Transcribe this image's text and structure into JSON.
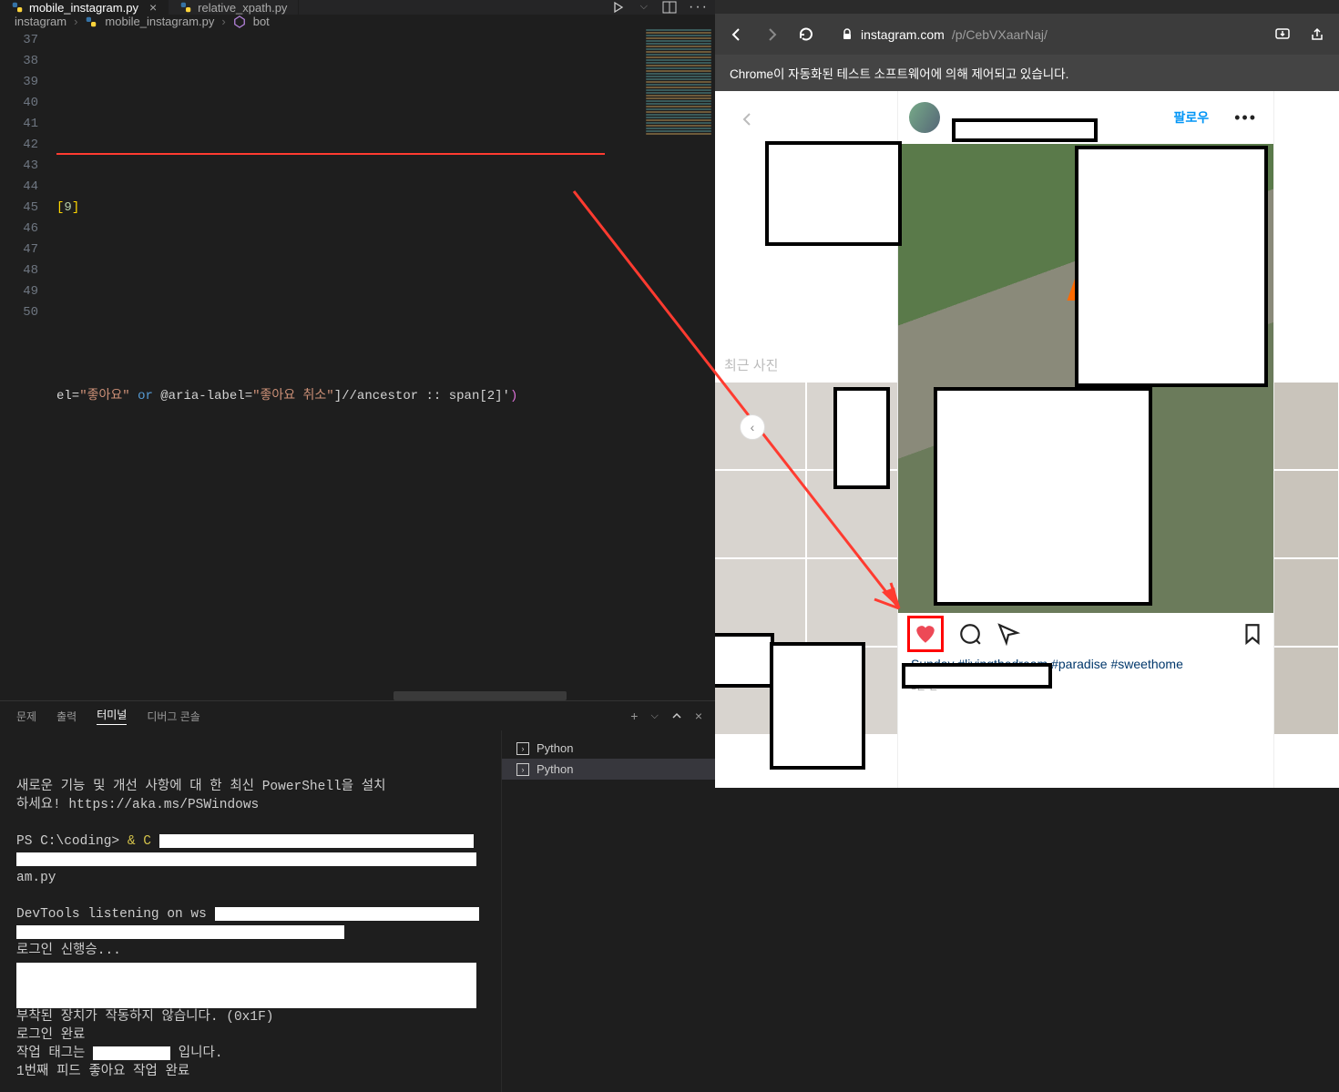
{
  "vscode": {
    "tabs": [
      {
        "name": "mobile_instagram.py",
        "active": true
      },
      {
        "name": "relative_xpath.py",
        "active": false
      }
    ],
    "breadcrumb": {
      "folder": "instagram",
      "file": "mobile_instagram.py",
      "symbol": "bot"
    },
    "gutter_lines": [
      "37",
      "38",
      "39",
      "40",
      "41",
      "42",
      "43",
      "44",
      "45",
      "46",
      "47",
      "48",
      "49",
      "50"
    ],
    "code_line_39": "[9]",
    "code_line_42_prefix": "el=",
    "code_line_42_str1": "\"좋아요\"",
    "code_line_42_or": " or ",
    "code_line_42_at": "@aria-label=",
    "code_line_42_str2": "\"좋아요 취소\"",
    "code_line_42_x": "]//ancestor :: span[2]'",
    "panel_tabs": {
      "problems": "문제",
      "output": "출력",
      "terminal": "터미널",
      "debug": "디버그 콘솔"
    },
    "terminal_list": [
      "Python",
      "Python"
    ],
    "terminal_text": {
      "l1": "새로운 기능 및 개선 사항에 대 한 최신 PowerShell을 설치",
      "l2": "하세요! https://aka.ms/PSWindows",
      "l3a": "PS C:\\coding> ",
      "l3b": "& C",
      "l4": "am.py",
      "l5": "DevTools listening on ws",
      "l6": "로그인 신행승...",
      "l7": " 부착된 장치가 작동하지 않습니다. (0x1F)",
      "l8": "로그인 완료",
      "l9a": "작업 태그는 ",
      "l9b": " 입니다.",
      "l10": "1번째 피드 좋아요 작업 완료"
    }
  },
  "browser": {
    "url_domain": "instagram.com",
    "url_path": "/p/CebVXaarNaj/",
    "info_strip": "Chrome이 자동화된 테스트 소프트웨어에 의해 제어되고 있습니다."
  },
  "instagram": {
    "recent_label": "최근 사진",
    "follow_label": "팔로우",
    "caption_tail": "Sunday #livingthedream #paradise #sweethome",
    "time_ago": "1분 전"
  }
}
